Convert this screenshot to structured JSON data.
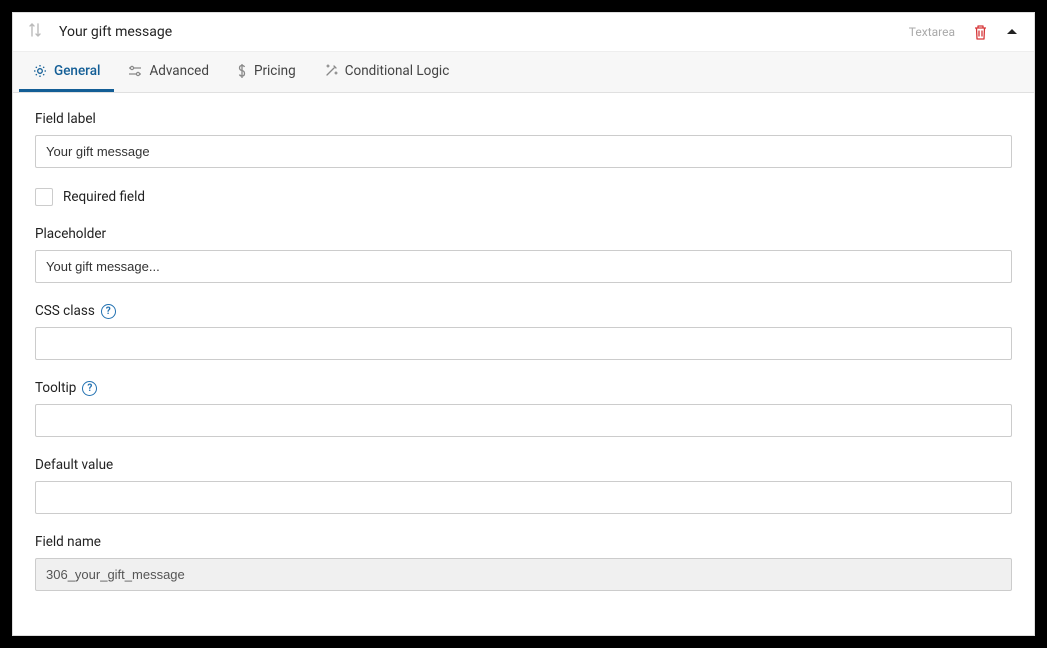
{
  "header": {
    "title": "Your gift message",
    "field_type": "Textarea"
  },
  "tabs": {
    "general": "General",
    "advanced": "Advanced",
    "pricing": "Pricing",
    "conditional": "Conditional Logic"
  },
  "form": {
    "field_label": {
      "label": "Field label",
      "value": "Your gift message"
    },
    "required": {
      "label": "Required field"
    },
    "placeholder": {
      "label": "Placeholder",
      "value": "Yout gift message..."
    },
    "css_class": {
      "label": "CSS class",
      "value": ""
    },
    "tooltip": {
      "label": "Tooltip",
      "value": ""
    },
    "default_value": {
      "label": "Default value",
      "value": ""
    },
    "field_name": {
      "label": "Field name",
      "value": "306_your_gift_message"
    }
  }
}
